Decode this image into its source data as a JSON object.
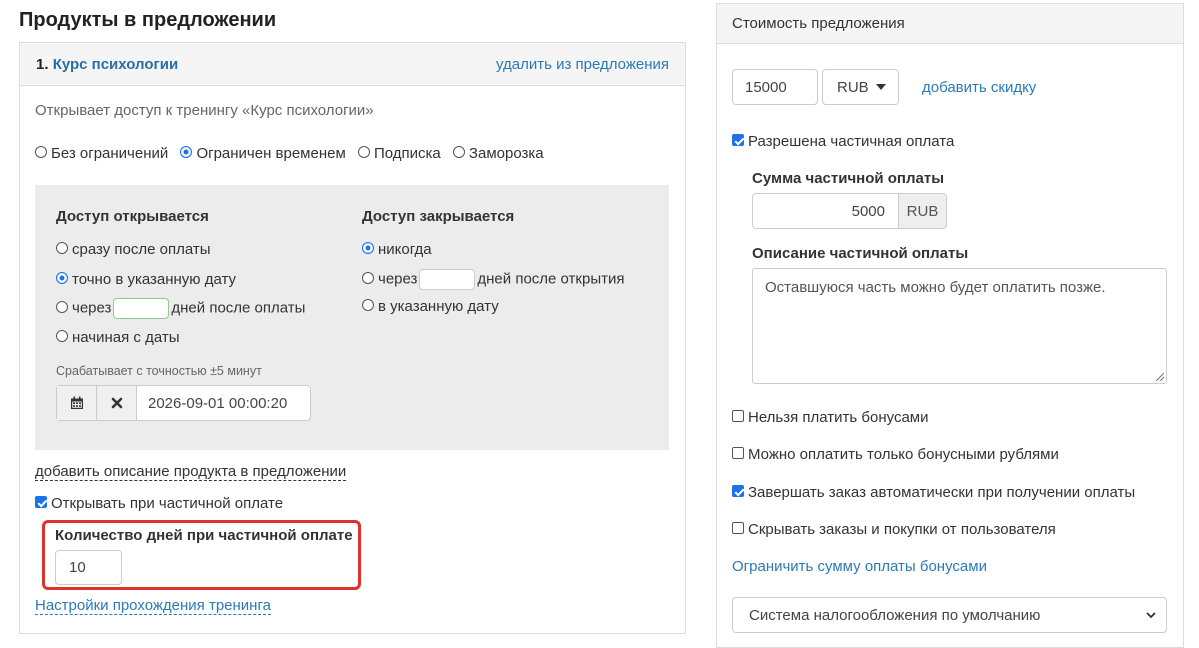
{
  "left": {
    "title": "Продукты в предложении",
    "product": {
      "number": "1.",
      "name": "Курс психологии",
      "remove_link": "удалить из предложения",
      "grants_text": "Открывает доступ к тренингу «Курс психологии»"
    },
    "access_types": [
      {
        "label": "Без ограничений",
        "checked": false
      },
      {
        "label": "Ограничен временем",
        "checked": true
      },
      {
        "label": "Подписка",
        "checked": false
      },
      {
        "label": "Заморозка",
        "checked": false
      }
    ],
    "open": {
      "heading": "Доступ открывается",
      "options": {
        "immediately": "сразу после оплаты",
        "exact_date": "точно в указанную дату",
        "after_prefix": "через",
        "after_suffix": "дней после оплаты",
        "from_date": "начиная с даты"
      },
      "selected": "exact_date",
      "precision_hint": "Срабатывает с точностью ±5 минут",
      "datetime_value": "2026-09-01 00:00:20"
    },
    "close": {
      "heading": "Доступ закрывается",
      "options": {
        "never": "никогда",
        "after_prefix": "через",
        "after_suffix": "дней после открытия",
        "on_date": "в указанную дату"
      },
      "selected": "never"
    },
    "add_description_link": "добавить описание продукта в предложении",
    "open_on_partial": {
      "label": "Открывать при частичной оплате",
      "checked": true
    },
    "partial_days": {
      "label": "Количество дней при частичной оплате",
      "value": "10"
    },
    "training_settings_link": "Настройки прохождения тренинга"
  },
  "right": {
    "header": "Стоимость предложения",
    "price_value": "15000",
    "currency": "RUB",
    "add_discount_link": "добавить скидку",
    "partial_allowed": {
      "label": "Разрешена частичная оплата",
      "checked": true
    },
    "partial_sum": {
      "label": "Сумма частичной оплаты",
      "value": "5000",
      "currency": "RUB"
    },
    "partial_desc": {
      "label": "Описание частичной оплаты",
      "value": "Оставшуюся часть можно будет оплатить позже."
    },
    "checkboxes": [
      {
        "label": "Нельзя платить бонусами",
        "checked": false
      },
      {
        "label": "Можно оплатить только бонусными рублями",
        "checked": false
      },
      {
        "label": "Завершать заказ автоматически при получении оплаты",
        "checked": true
      },
      {
        "label": "Скрывать заказы и покупки от пользователя",
        "checked": false
      }
    ],
    "limit_bonus_link": "Ограничить сумму оплаты бонусами",
    "tax_system": "Система налогообложения по умолчанию"
  },
  "colors": {
    "link": "#2a7ab8",
    "accent": "#1a73e8",
    "highlight_border": "#e0312a",
    "panel_bg": "#f5f5f5",
    "access_box_bg": "#ececec"
  }
}
